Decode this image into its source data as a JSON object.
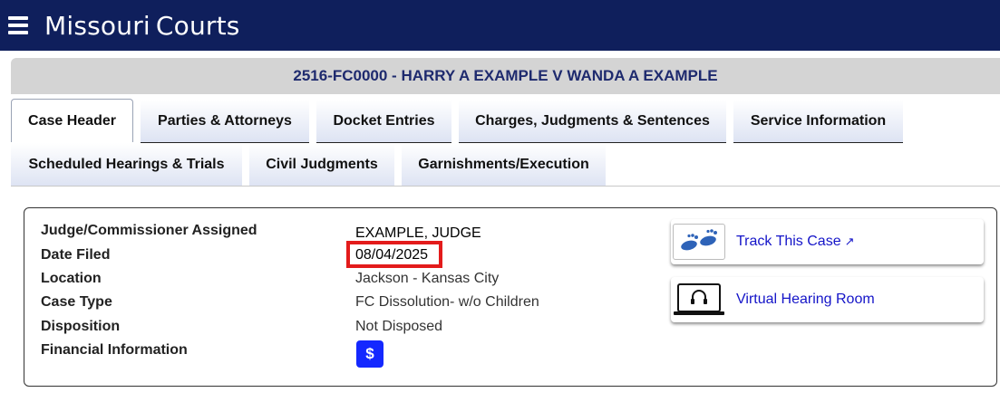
{
  "app": {
    "brand_part1": "Missouri",
    "brand_part2": "Courts"
  },
  "case": {
    "title": "2516-FC0000 - HARRY A EXAMPLE V WANDA A EXAMPLE"
  },
  "tabs": [
    {
      "label": "Case Header",
      "active": true
    },
    {
      "label": "Parties & Attorneys"
    },
    {
      "label": "Docket Entries"
    },
    {
      "label": "Charges, Judgments & Sentences"
    },
    {
      "label": "Service Information"
    },
    {
      "label": "Scheduled Hearings & Trials"
    },
    {
      "label": "Civil Judgments"
    },
    {
      "label": "Garnishments/Execution"
    }
  ],
  "details": [
    {
      "label": "Judge/Commissioner Assigned",
      "value": "EXAMPLE, JUDGE"
    },
    {
      "label": "Date Filed",
      "value": "08/04/2025"
    },
    {
      "label": "Location",
      "value": "Jackson - Kansas City"
    },
    {
      "label": "Case Type",
      "value": "FC Dissolution- w/o Children"
    },
    {
      "label": "Disposition",
      "value": "Not Disposed"
    },
    {
      "label": "Financial Information",
      "value": ""
    }
  ],
  "financial_icon": {
    "symbol": "$"
  },
  "actions": {
    "track": {
      "label": "Track This Case",
      "icon": "footprints-icon"
    },
    "virtual": {
      "label": "Virtual Hearing Room",
      "icon": "laptop-headphones-icon"
    }
  },
  "colors": {
    "header_bg": "#0f1f5c",
    "highlight": "#e31b1b",
    "link": "#1414c8",
    "dollar_bg": "#1428ff"
  }
}
